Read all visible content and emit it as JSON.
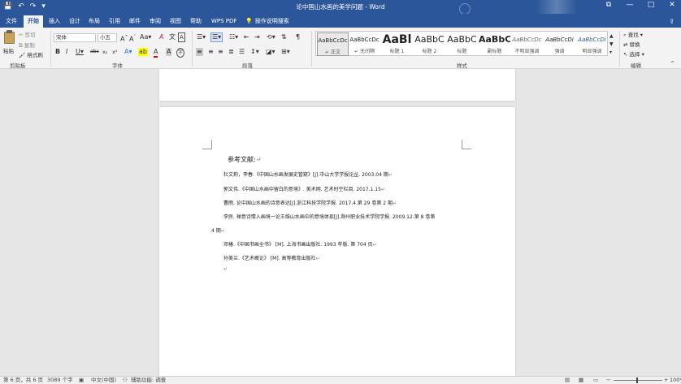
{
  "window": {
    "title": "论中国山水画的美学问题 - Word",
    "controls": {
      "minimize": "—",
      "maximize": "□",
      "close": "✕",
      "restore": "⧉"
    }
  },
  "qat": {
    "save_icon": "save-icon",
    "undo": "↶",
    "redo": "↷",
    "more": "▾"
  },
  "tabs": [
    {
      "label": "文件"
    },
    {
      "label": "开始",
      "active": true
    },
    {
      "label": "插入"
    },
    {
      "label": "设计"
    },
    {
      "label": "布局"
    },
    {
      "label": "引用"
    },
    {
      "label": "邮件"
    },
    {
      "label": "审阅"
    },
    {
      "label": "视图"
    },
    {
      "label": "帮助"
    },
    {
      "label": "WPS PDF"
    }
  ],
  "tell_me": {
    "icon": "lightbulb-icon",
    "text": "操作说明搜索"
  },
  "ribbon": {
    "clipboard": {
      "paste": "粘贴",
      "cut": "剪切",
      "copy": "复制",
      "format_painter": "格式刷",
      "group": "剪贴板"
    },
    "font": {
      "font_name": "宋体",
      "font_size": "小五",
      "group": "字体"
    },
    "paragraph": {
      "group": "段落"
    },
    "styles": {
      "group": "样式",
      "items": [
        {
          "preview": "AaBbCcDc",
          "name": "↵ 正文",
          "selected": true
        },
        {
          "preview": "AaBbCcDc",
          "name": "↵ 无间隔"
        },
        {
          "preview": "AaBl",
          "name": "标题 1"
        },
        {
          "preview": "AaBbC",
          "name": "标题 2"
        },
        {
          "preview": "AaBbC",
          "name": "标题"
        },
        {
          "preview": "AaBbC",
          "name": "副标题"
        },
        {
          "preview": "AaBbCcDc",
          "name": "不明显强调"
        },
        {
          "preview": "AaBbCcDi",
          "name": "强调"
        },
        {
          "preview": "AaBbCcDi",
          "name": "明显强调"
        }
      ]
    },
    "editing": {
      "find": "查找",
      "replace": "替换",
      "select": "选择",
      "group": "编辑"
    }
  },
  "document": {
    "ref_title": "参考文献:",
    "references": [
      "杜文莉，李春.《中国山水画发展史管窥》[J].中山大学学报论丛. 2003.04 期",
      "郭文伟.《中国山水画中留白的意境》. 美术网. 艺术时空栏目. 2017.1.15",
      "曹雨. 论中国山水画的诗意表达[J].浙江科技学院学报. 2017.4.第 29 卷第 2 期",
      "李民. 禅意诗情入画境一论王维山水画中的意境体现[J].滁州职业技术学院学报. 2009.12.第 8 卷第",
      "4 期",
      "邓椿.《中国书画全书》 [M]. 上海书画出版社. 1993 年版. 第 704 页",
      "孙美兰.《艺术概论》 [M]. 高等教育出版社"
    ]
  },
  "status": {
    "page": "第 6 页，共 6 页",
    "words": "3089 个字",
    "language": "中文(中国)",
    "accessibility": "辅助功能: 调查",
    "zoom": "100%"
  }
}
